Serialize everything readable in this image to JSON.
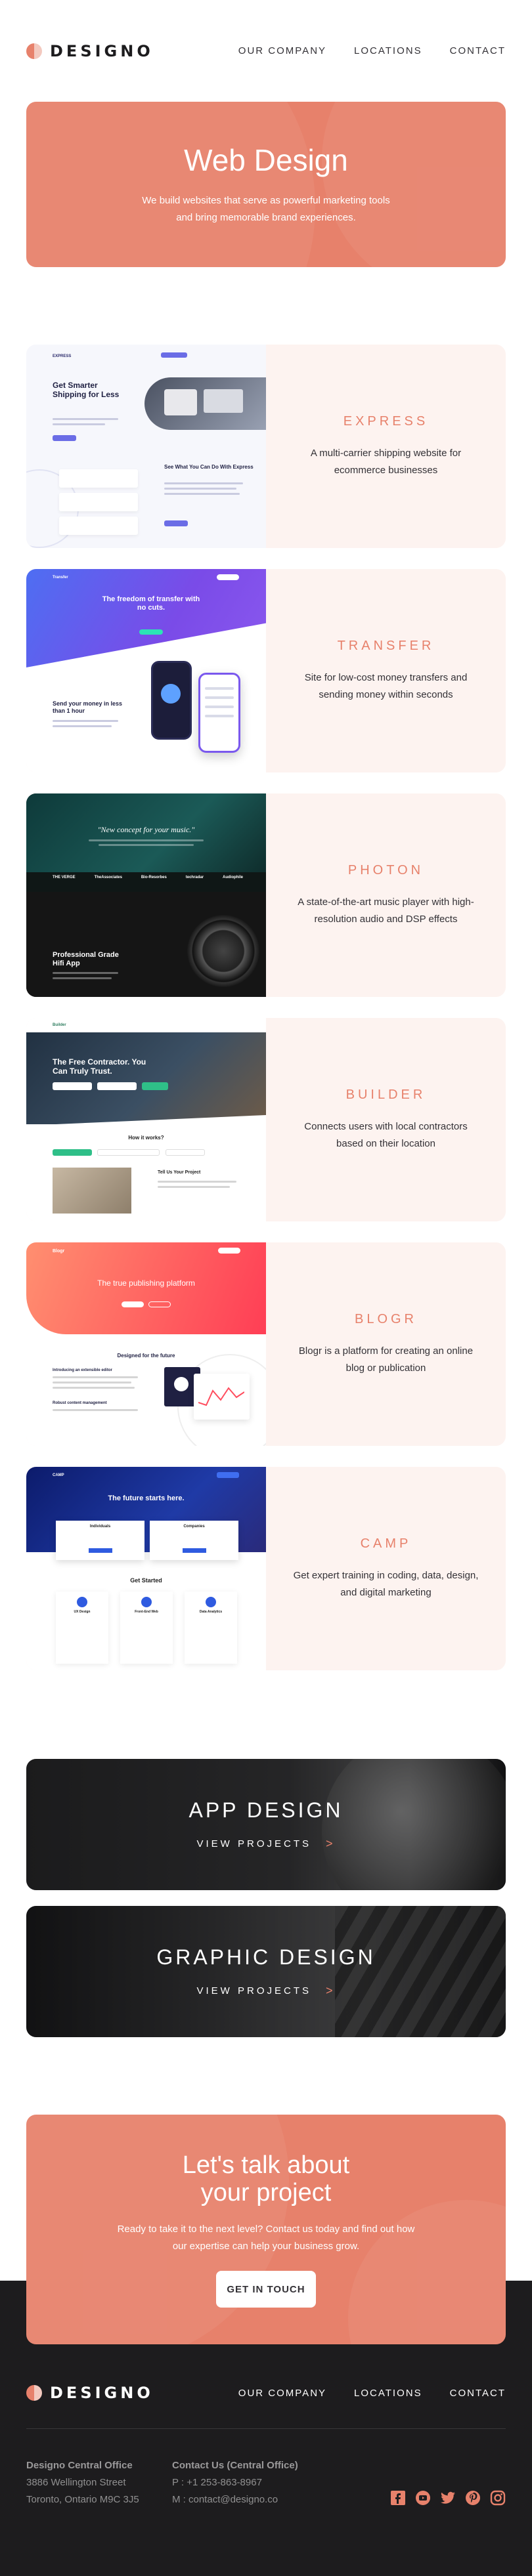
{
  "header": {
    "logo_text": "DESIGNO",
    "nav": [
      "OUR COMPANY",
      "LOCATIONS",
      "CONTACT"
    ]
  },
  "hero": {
    "title": "Web Design",
    "subtitle": "We build websites that serve as powerful marketing tools and bring memorable brand experiences."
  },
  "projects": [
    {
      "title": "EXPRESS",
      "description": "A multi-carrier shipping website for ecommerce businesses",
      "thumb": {
        "heading": "Get Smarter Shipping for Less",
        "subheading": "See What You Can Do With Express",
        "brand": "EXPRESS"
      }
    },
    {
      "title": "TRANSFER",
      "description": "Site for low-cost money transfers and sending money within seconds",
      "thumb": {
        "heading": "The freedom of transfer with no cuts.",
        "subheading": "Send your money in less than 1 hour",
        "brand": "Transfer"
      }
    },
    {
      "title": "PHOTON",
      "description": "A state-of-the-art music player with high-resolution audio and DSP effects",
      "thumb": {
        "heading": "\"New concept for your music.\"",
        "subheading": "Professional Grade Hifi App",
        "brands": [
          "THE VERGE",
          "TheAssociates",
          "Bio-Resorbes",
          "techradar",
          "Audiophile"
        ]
      }
    },
    {
      "title": "BUILDER",
      "description": "Connects users with local contractors based on their location",
      "thumb": {
        "heading": "The Free Contractor. You Can Truly Trust.",
        "subheading": "How it works?",
        "caption": "Tell Us Your Project",
        "brand": "Builder"
      }
    },
    {
      "title": "BLOGR",
      "description": "Blogr is a platform for creating an online blog or publication",
      "thumb": {
        "heading": "The true publishing platform",
        "subheading": "Designed for the future",
        "caption": "Introducing an extensible editor",
        "caption2": "Robust content management",
        "brand": "Blogr"
      }
    },
    {
      "title": "CAMP",
      "description": "Get expert training in coding, data, design, and digital marketing",
      "thumb": {
        "heading": "The future starts here.",
        "subheading": "Get Started",
        "cards": [
          "Individuals",
          "Companies"
        ],
        "steps": [
          "UX Design",
          "Front-End Web",
          "Data Analytics"
        ],
        "brand": "CAMP"
      }
    }
  ],
  "categories": [
    {
      "title": "APP DESIGN",
      "link": "VIEW PROJECTS"
    },
    {
      "title": "GRAPHIC DESIGN",
      "link": "VIEW PROJECTS"
    }
  ],
  "cta": {
    "title_line1": "Let's talk about",
    "title_line2": "your project",
    "text": "Ready to take it to the next level? Contact us today and find out how our expertise can help your business grow.",
    "button": "GET IN TOUCH"
  },
  "footer": {
    "logo_text": "DESIGNO",
    "nav": [
      "OUR COMPANY",
      "LOCATIONS",
      "CONTACT"
    ],
    "office": {
      "title": "Designo Central Office",
      "line1": "3886 Wellington Street",
      "line2": "Toronto, Ontario M9C 3J5"
    },
    "contact": {
      "title": "Contact Us (Central Office)",
      "phone": "P : +1 253-863-8967",
      "email": "M : contact@designo.co"
    },
    "social": [
      "facebook-icon",
      "youtube-icon",
      "twitter-icon",
      "pinterest-icon",
      "instagram-icon"
    ]
  },
  "colors": {
    "peach": "#e7816b",
    "light_peach": "#fdf3f0",
    "dark": "#1d1c1e",
    "text": "#333136"
  }
}
